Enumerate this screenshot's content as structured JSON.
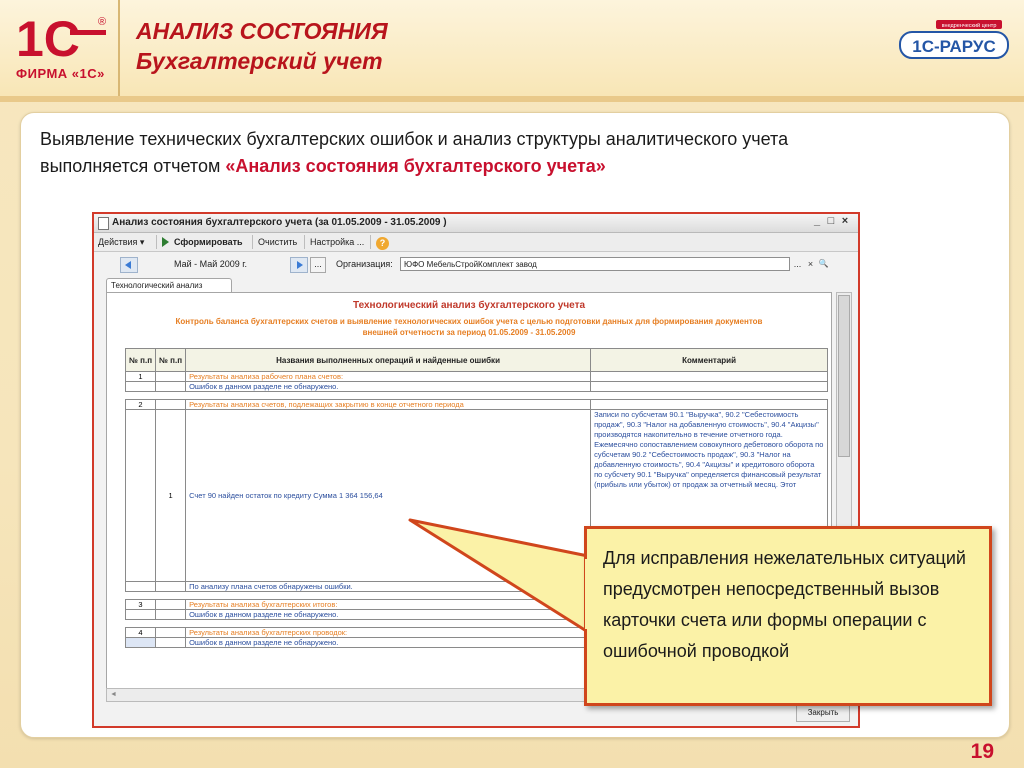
{
  "header": {
    "title_line1": "АНАЛИЗ СОСТОЯНИЯ",
    "title_line2": "Бухгалтерский учет",
    "logo_text": "1С",
    "logo_firm": "ФИРМА «1С»",
    "logo_reg": "®",
    "partner_logo_small": "внедренческий центр",
    "partner_logo": "1С-РАРУС"
  },
  "intro": {
    "text_part1": "Выявление технических бухгалтерских ошибок и анализ структуры аналитического учета выполняется отчетом ",
    "text_highlight": "«Анализ состояния бухгалтерского учета»"
  },
  "window": {
    "title": "Анализ состояния бухгалтерского учета (за 01.05.2009  - 31.05.2009 )",
    "controls": {
      "minimize": "_",
      "maximize": "□",
      "close": "×"
    },
    "toolbar": {
      "actions_label": "Действия ▾",
      "generate_label": "Сформировать",
      "clear_label": "Очистить",
      "settings_label": "Настройка ...",
      "help_label": "?"
    },
    "period_text": "Май - Май 2009 г.",
    "period_more": "...",
    "org_label": "Организация:",
    "org_value": "ЮФО МебельСтройКомплект завод",
    "org_select": "...",
    "org_clear": "×",
    "org_search": "🔍",
    "tab_label": "Технологический анализ",
    "close_button": "Закрыть"
  },
  "report": {
    "title": "Технологический анализ бухгалтерского учета",
    "subtitle_line1": "Контроль баланса бухгалтерских счетов и выявление технологических ошибок учета с целью подготовки данных для формирования документов",
    "subtitle_line2": "внешней отчетности за период 01.05.2009  - 31.05.2009",
    "columns": [
      "№ п.п",
      "№ п.п",
      "Названия выполненных операций и найденные ошибки",
      "Комментарий"
    ],
    "rows": [
      {
        "n1": "1",
        "n2": "",
        "text": "Результаты анализа рабочего плана счетов:",
        "style": "y",
        "comment": ""
      },
      {
        "n1": "",
        "n2": "",
        "text": "Ошибок в данном разделе не обнаружено.",
        "style": "b",
        "comment": ""
      },
      {
        "n1": "2",
        "n2": "",
        "text": "Результаты анализа счетов, подлежащих закрытию в конце отчетного периода",
        "style": "y",
        "comment": ""
      },
      {
        "n1": "",
        "n2": "1",
        "text": "Счет 90 найден остаток по кредиту Сумма 1 364 156,64",
        "style": "b",
        "comment": "Записи по субсчетам 90.1 \"Выручка\", 90.2 \"Себестоимость продаж\", 90.3 \"Налог на добавленную стоимость\", 90.4 \"Акцизы\" производятся накопительно в течение отчетного года. Ежемесячно сопоставлением совокупного дебетового оборота по субсчетам 90.2 \"Себестоимость продаж\", 90.3 \"Налог на добавленную стоимость\", 90.4 \"Акцизы\" и кредитового оборота по субсчету 90.1 \"Выручка\" определяется финансовый результат (прибыль или убыток) от продаж за отчетный месяц. Этот"
      },
      {
        "n1": "",
        "n2": "",
        "text": "По анализу плана счетов обнаружены ошибки.",
        "style": "b",
        "comment": ""
      },
      {
        "n1": "3",
        "n2": "",
        "text": "Результаты анализа бухгалтерских итогов:",
        "style": "y",
        "comment": ""
      },
      {
        "n1": "",
        "n2": "",
        "text": "Ошибок в данном разделе не обнаружено.",
        "style": "b",
        "comment": ""
      },
      {
        "n1": "4",
        "n2": "",
        "text": "Результаты анализа бухгалтерских проводок:",
        "style": "y",
        "comment": ""
      },
      {
        "n1": "",
        "n2": "",
        "text": "Ошибок в данном разделе не обнаружено.",
        "style": "b",
        "comment": ""
      }
    ]
  },
  "callout": {
    "text": "Для исправления нежелательных ситуаций  предусмотрен непосредственный вызов карточки счета или формы операции с ошибочной проводкой"
  },
  "page_number": "19",
  "colors": {
    "brand_red": "#c8102e",
    "callout_border": "#d0461c",
    "callout_bg": "#fbf2a7"
  }
}
